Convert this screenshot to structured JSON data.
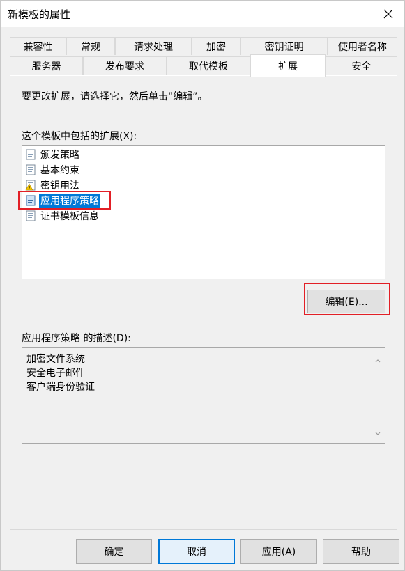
{
  "window": {
    "title": "新模板的属性"
  },
  "tabs_row1": [
    "兼容性",
    "常规",
    "请求处理",
    "加密",
    "密钥证明",
    "使用者名称"
  ],
  "tabs_row2": [
    "服务器",
    "发布要求",
    "取代模板",
    "扩展",
    "安全"
  ],
  "active_tab": "扩展",
  "instruction": "要更改扩展，请选择它，然后单击“编辑”。",
  "extensions": {
    "label": "这个模板中包括的扩展(X):",
    "items": [
      {
        "label": "颁发策略",
        "icon": "certificate-extension-icon"
      },
      {
        "label": "基本约束",
        "icon": "certificate-extension-icon"
      },
      {
        "label": "密钥用法",
        "icon": "certificate-extension-warning-icon"
      },
      {
        "label": "应用程序策略",
        "icon": "certificate-extension-icon",
        "selected": true
      },
      {
        "label": "证书模板信息",
        "icon": "certificate-extension-icon"
      }
    ]
  },
  "edit_button": "编辑(E)...",
  "description": {
    "label": "应用程序策略 的描述(D):",
    "lines": [
      "加密文件系统",
      "安全电子邮件",
      "客户端身份验证"
    ]
  },
  "footer": {
    "ok": "确定",
    "cancel": "取消",
    "apply": "应用(A)",
    "help": "帮助"
  },
  "colors": {
    "highlight": "#e21f26",
    "selection": "#0078d7"
  }
}
